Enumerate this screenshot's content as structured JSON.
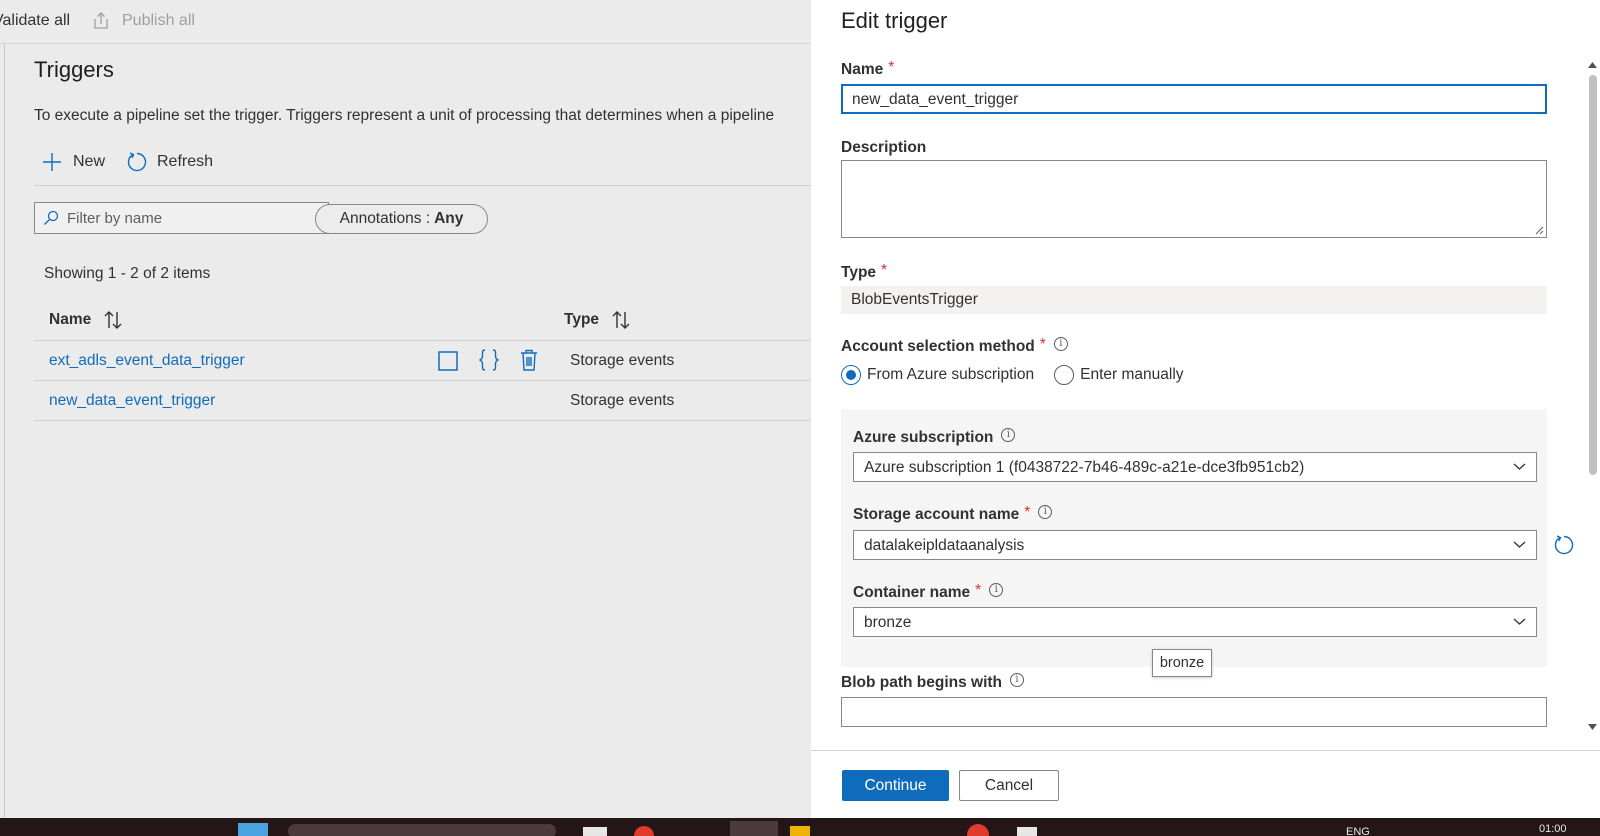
{
  "toolbar": {
    "validate_all": "Validate all",
    "publish_all": "Publish all"
  },
  "triggers": {
    "title": "Triggers",
    "description": "To execute a pipeline set the trigger. Triggers represent a unit of processing that determines when a pipeline",
    "new_label": "New",
    "refresh_label": "Refresh",
    "filter_placeholder": "Filter by name",
    "annotations_label": "Annotations :",
    "annotations_value": "Any",
    "showing": "Showing 1 - 2 of 2 items",
    "columns": {
      "name": "Name",
      "type": "Type"
    },
    "rows": [
      {
        "name": "ext_adls_event_data_trigger",
        "type": "Storage events"
      },
      {
        "name": "new_data_event_trigger",
        "type": "Storage events"
      }
    ]
  },
  "panel": {
    "title": "Edit trigger",
    "name_label": "Name",
    "name_value": "new_data_event_trigger",
    "description_label": "Description",
    "type_label": "Type",
    "type_value": "BlobEventsTrigger",
    "account_method_label": "Account selection method",
    "radio_from_azure": "From Azure subscription",
    "radio_manual": "Enter manually",
    "subscription_label": "Azure subscription",
    "subscription_value": "Azure subscription 1 (f0438722-7b46-489c-a21e-dce3fb951cb2)",
    "storage_label": "Storage account name",
    "storage_value": "datalakeipldataanalysis",
    "container_label": "Container name",
    "container_value": "bronze",
    "tooltip": "bronze",
    "blob_path_label": "Blob path begins with",
    "required_mark": "*",
    "info_mark": "i",
    "continue_label": "Continue",
    "cancel_label": "Cancel"
  },
  "taskbar": {
    "language": "ENG",
    "time": "01:00"
  },
  "colors": {
    "accent": "#0f6cbd",
    "required": "#d13438",
    "overlay": "#ebebeb",
    "taskbar": "#241517"
  }
}
